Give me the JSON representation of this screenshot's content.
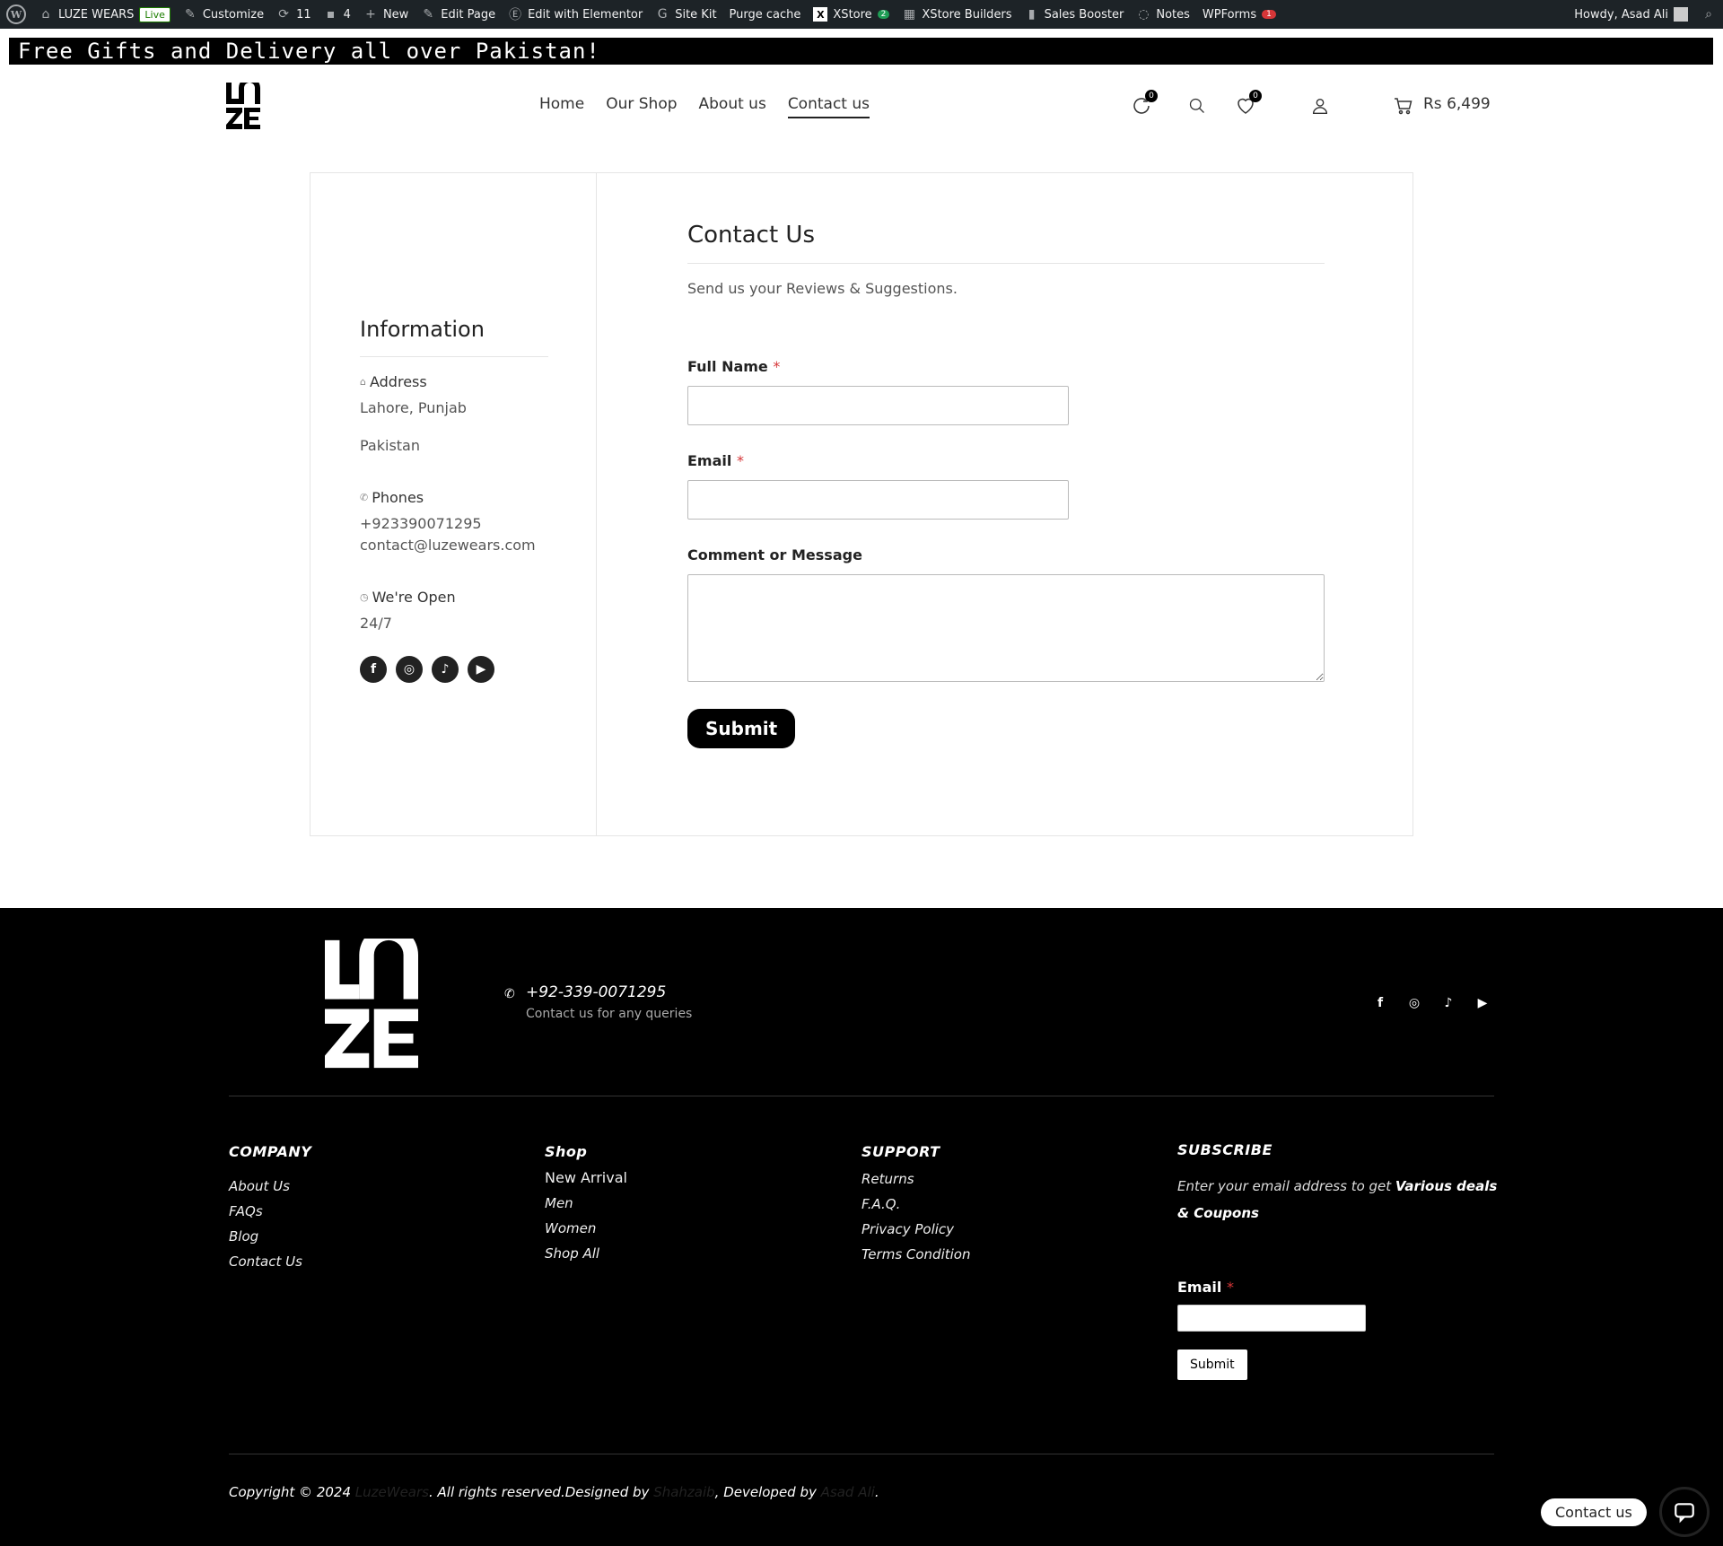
{
  "adminbar": {
    "site_name": "LUZE WEARS",
    "live_badge": "Live",
    "customize": "Customize",
    "updates_count": "11",
    "comments_count": "4",
    "new": "New",
    "edit_page": "Edit Page",
    "edit_elementor": "Edit with Elementor",
    "site_kit": "Site Kit",
    "purge_cache": "Purge cache",
    "xstore": "XStore",
    "xstore_count": "2",
    "xstore_builders": "XStore Builders",
    "sales_booster": "Sales Booster",
    "notes": "Notes",
    "wpforms": "WPForms",
    "wpforms_count": "1",
    "howdy": "Howdy, Asad Ali"
  },
  "promo": {
    "text": "Free Gifts and Delivery all over Pakistan!"
  },
  "header": {
    "nav": [
      "Home",
      "Our Shop",
      "About us",
      "Contact us"
    ],
    "active_nav": "Contact us",
    "compare_count": "0",
    "wishlist_count": "0",
    "cart_total": "Rs 6,499"
  },
  "info": {
    "title": "Information",
    "address_label": "Address",
    "address_line1": "Lahore, Punjab",
    "address_line2": "Pakistan",
    "phones_label": "Phones",
    "phone": "+923390071295",
    "email": "contact@luzewears.com",
    "open_label": "We're Open",
    "open_value": "24/7"
  },
  "form": {
    "title": "Contact Us",
    "subtitle": "Send us your Reviews & Suggestions.",
    "full_name_label": "Full Name",
    "email_label": "Email",
    "message_label": "Comment or Message",
    "required_mark": "*",
    "submit_label": "Submit"
  },
  "footer": {
    "phone": "+92-339-0071295",
    "phone_note": "Contact us for any queries",
    "company": {
      "title": "COMPANY",
      "items": [
        "About Us",
        "FAQs",
        "Blog",
        "Contact Us"
      ]
    },
    "shop": {
      "title": "Shop",
      "items": [
        "New Arrival",
        "Men",
        "Women",
        "Shop All"
      ]
    },
    "support": {
      "title": "SUPPORT",
      "items": [
        "Returns",
        "F.A.Q.",
        "Privacy Policy",
        "Terms Condition"
      ]
    },
    "subscribe": {
      "title": "SUBSCRIBE",
      "text_prefix": "Enter your email address to get ",
      "text_bold": "Various deals & Coupons",
      "email_label": "Email",
      "required_mark": "*",
      "submit_label": "Submit"
    },
    "copyright": {
      "prefix": "Copyright © 2024 ",
      "brand": "LuzeWears",
      "middle": ". All rights reserved.Designed by ",
      "designer": "Shahzaib",
      "developed": ", Developed by ",
      "developer": "Asad Ali",
      "suffix": "."
    }
  },
  "chat": {
    "label": "Contact us"
  }
}
